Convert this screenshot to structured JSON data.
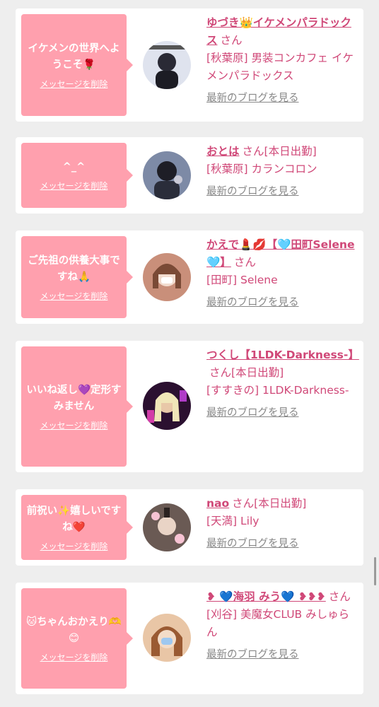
{
  "delete_label": "メッセージを削除",
  "blog_label": "最新のブログを見る",
  "san_label": "さん",
  "colors": {
    "accent": "#d04878",
    "bubble": "#ffa0ae",
    "background": "#eeeeee",
    "link_gray": "#888888"
  },
  "messages": [
    {
      "text": "イケメンの世界へようこそ🌹",
      "name": "ゆづき👑イケメンパラドックス",
      "status": "",
      "shop": "[秋葉原] 男装コンカフェ イケメンパラドックス"
    },
    {
      "text": "^_^",
      "name": "おとは",
      "status": "[本日出勤]",
      "shop": "[秋葉原] カランコロン"
    },
    {
      "text": "ご先祖の供養大事ですね🙏",
      "name": "かえで💄💋【🩵田町Selene🩵】",
      "status": "",
      "shop": "[田町] Selene"
    },
    {
      "text": "いいね返し💜定形すみません",
      "name": "つくし【1LDK-Darkness-】",
      "status": "[本日出勤]",
      "shop": "[すすきの] 1LDK-Darkness-"
    },
    {
      "text": "前祝い✨嬉しいですね❤️",
      "name": "nao",
      "status": "[本日出勤]",
      "shop": "[天満] Lily"
    },
    {
      "text": "🐱ちゃんおかえり🫶😊",
      "name": "❥ 💙海羽 みう💙 ❥❥❥",
      "status": "",
      "shop": "[刈谷] 美魔女CLUB みしゅらん"
    }
  ]
}
